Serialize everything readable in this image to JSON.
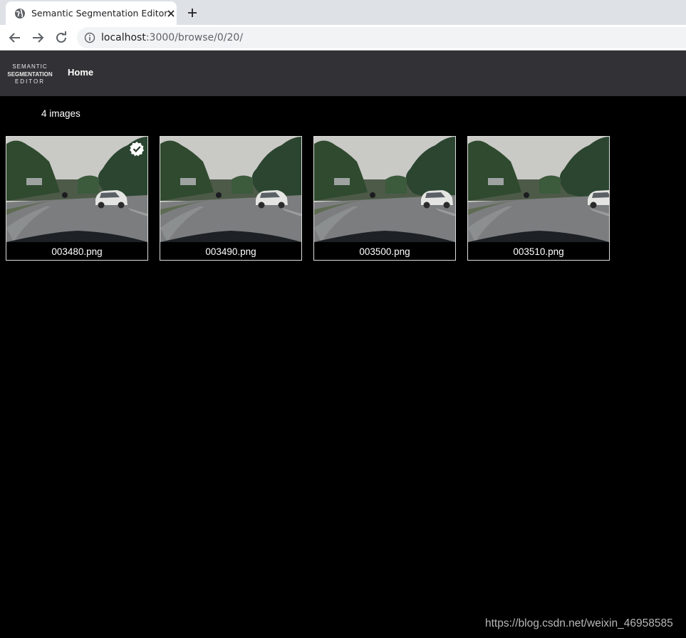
{
  "browser": {
    "tab_title": "Semantic Segmentation Editor",
    "url_host": "localhost",
    "url_rest": ":3000/browse/0/20/"
  },
  "app": {
    "logo_line1": "SEMANTIC",
    "logo_line2": "SEGMENTATION",
    "logo_line3": "EDITOR",
    "home_label": "Home"
  },
  "gallery": {
    "count_label": "4 images",
    "images": [
      {
        "name": "003480.png",
        "checked": true,
        "car_x": 0.73
      },
      {
        "name": "003490.png",
        "checked": false,
        "car_x": 0.78
      },
      {
        "name": "003500.png",
        "checked": false,
        "car_x": 0.86
      },
      {
        "name": "003510.png",
        "checked": false,
        "car_x": 0.95
      }
    ]
  },
  "watermark": "https://blog.csdn.net/weixin_46958585"
}
